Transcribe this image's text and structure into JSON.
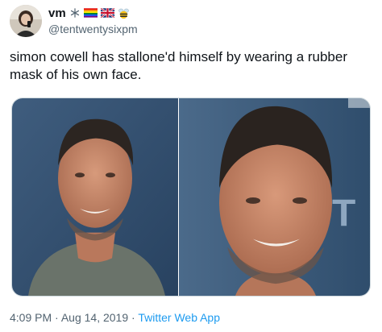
{
  "user": {
    "display_name": "vm",
    "handle": "@tentwentysixpm",
    "badges": [
      "snowflake-icon",
      "rainbow-flag-icon",
      "uk-flag-icon",
      "bee-icon"
    ]
  },
  "tweet": {
    "text": "simon cowell has stallone'd himself by wearing a rubber mask of his own face."
  },
  "media": {
    "photos": [
      "photo-left",
      "photo-right"
    ],
    "overlay_letter": "T"
  },
  "footer": {
    "time": "4:09 PM",
    "separator": "·",
    "date": "Aug 14, 2019",
    "source": "Twitter Web App"
  }
}
